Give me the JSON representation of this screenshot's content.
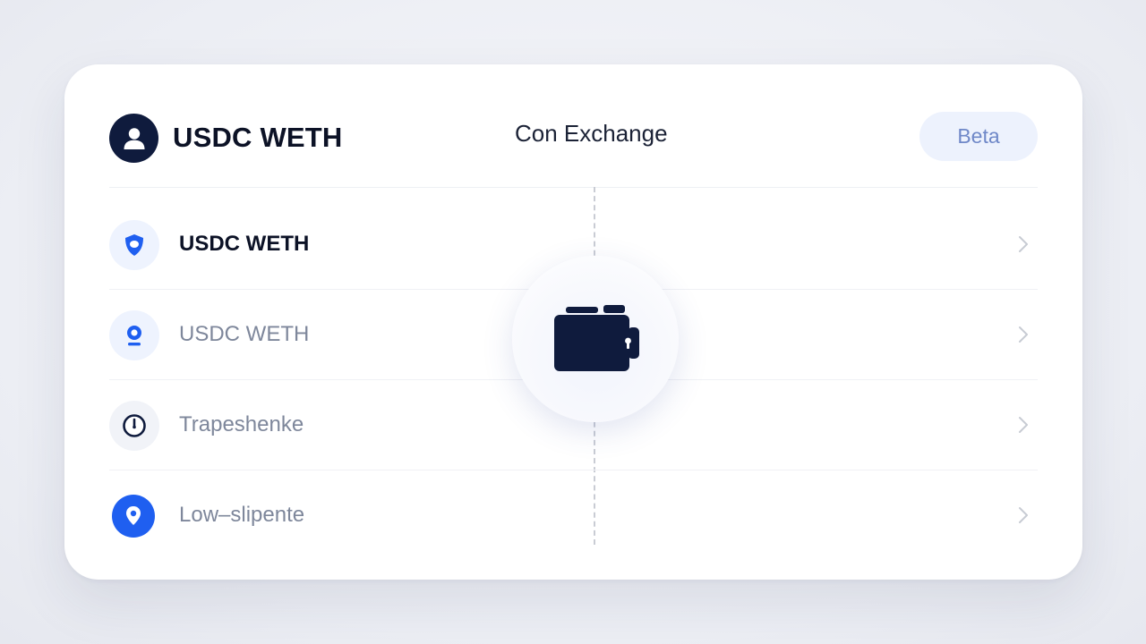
{
  "header": {
    "title": "USDC WETH",
    "center_label": "Con Exchange",
    "badge": "Beta"
  },
  "rows": [
    {
      "label": "USDC WETH",
      "icon": "shield-icon",
      "style": "primary"
    },
    {
      "label": "USDC WETH",
      "icon": "pin-icon",
      "style": "muted"
    },
    {
      "label": "Trapeshenke",
      "icon": "clock-icon",
      "style": "muted"
    },
    {
      "label": "Low–slipente",
      "icon": "location-icon",
      "style": "muted"
    }
  ],
  "center": {
    "icon": "wallet-icon"
  },
  "colors": {
    "navy": "#0f1b3d",
    "accent": "#1f5ff0",
    "muted_text": "#7e879b",
    "badge_bg": "#edf2fd",
    "badge_text": "#6f88c8"
  }
}
